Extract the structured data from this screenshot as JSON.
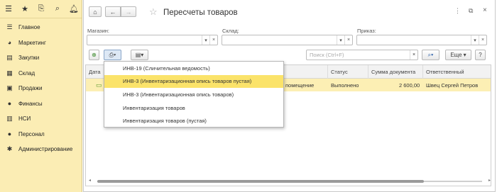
{
  "sidebar": {
    "top_icons": [
      "menu-icon",
      "star-icon",
      "history-icon",
      "search-icon",
      "bell-icon"
    ],
    "items": [
      {
        "label": "Главное",
        "icon": "list-icon"
      },
      {
        "label": "Маркетинг",
        "icon": "pie-chart-icon"
      },
      {
        "label": "Закупки",
        "icon": "cart-icon"
      },
      {
        "label": "Склад",
        "icon": "warehouse-icon"
      },
      {
        "label": "Продажи",
        "icon": "sales-icon"
      },
      {
        "label": "Финансы",
        "icon": "coins-icon"
      },
      {
        "label": "НСИ",
        "icon": "directory-icon"
      },
      {
        "label": "Персонал",
        "icon": "person-icon"
      },
      {
        "label": "Администрирование",
        "icon": "gear-icon"
      }
    ]
  },
  "header": {
    "title": "Пересчеты товаров"
  },
  "filters": {
    "store_label": "Магазин:",
    "warehouse_label": "Склад:",
    "order_label": "Приказ:"
  },
  "toolbar": {
    "search_placeholder": "Поиск (Ctrl+F)",
    "more_label": "Еще",
    "help_label": "?"
  },
  "table": {
    "columns": [
      "Дата",
      "Статус",
      "Сумма документа",
      "Ответственный"
    ],
    "rows": [
      {
        "location": "помещение",
        "status": "Выполнено",
        "amount": "2 600,00",
        "responsible": "Швец Сергей Петров"
      }
    ]
  },
  "print_menu": {
    "items": [
      "ИНВ-19 (Сличительная ведомость)",
      "ИНВ-3 (Инвентаризационная опись товаров пустая)",
      "ИНВ-3 (Инвентаризационная опись товаров)",
      "Инвентаризация товаров",
      "Инвентаризация товаров (пустая)"
    ],
    "highlighted_index": 1
  },
  "colors": {
    "sidebar_bg": "#fbedb4",
    "highlight": "#fbe36a",
    "selected_row": "#fcefb4"
  }
}
